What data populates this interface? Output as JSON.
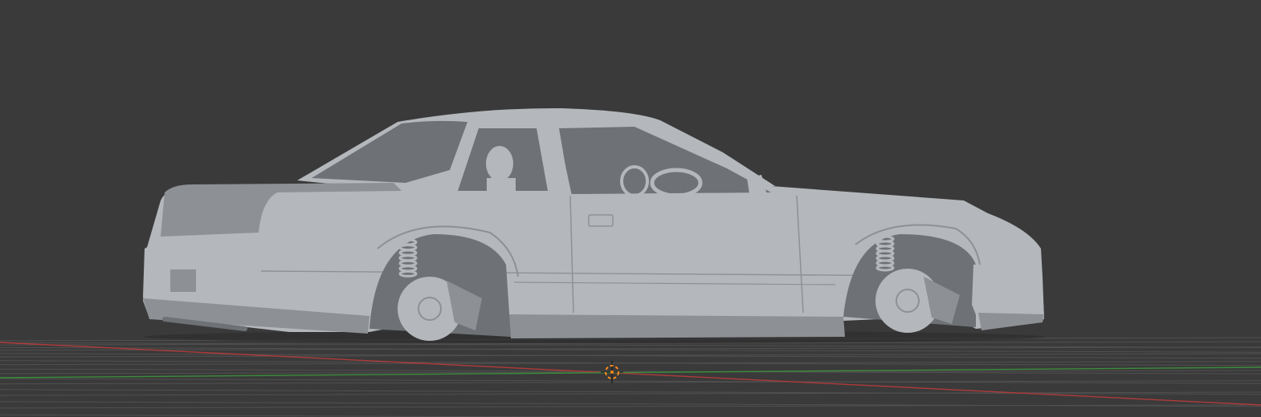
{
  "viewport": {
    "background_color": "#3a3a3a",
    "grid_color": "#505050",
    "x_axis_color": "#b03a3a",
    "y_axis_color": "#3c8c3c",
    "model_color": "#b4b7bb",
    "model_shadow_color": "#8d9094",
    "model_dark_color": "#6e7276",
    "cursor_color": "#ff8a1e",
    "shading_mode": "solid",
    "model_icon": "car-model-icon",
    "cursor_icon": "3d-cursor-icon"
  }
}
